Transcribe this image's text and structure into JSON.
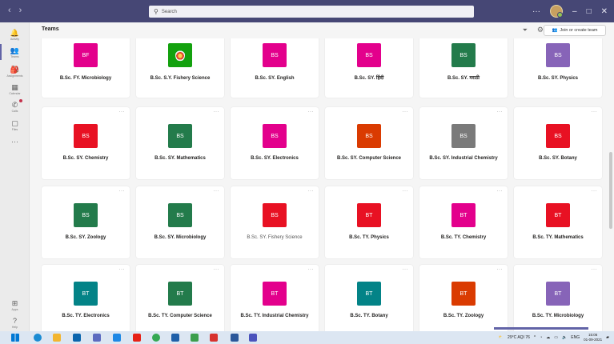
{
  "titlebar": {
    "back": "‹",
    "forward": "›",
    "search_placeholder": "Search",
    "more": "···",
    "minimize": "–",
    "maximize": "□",
    "close": "✕"
  },
  "rail": [
    {
      "name": "activity",
      "icon": "🔔",
      "label": "Activity"
    },
    {
      "name": "teams",
      "icon": "👥",
      "label": "Teams"
    },
    {
      "name": "assignments",
      "icon": "🎒",
      "label": "Assignments"
    },
    {
      "name": "calendar",
      "icon": "▦",
      "label": "Calendar"
    },
    {
      "name": "calls",
      "icon": "✆",
      "label": "Calls"
    },
    {
      "name": "files",
      "icon": "▢",
      "label": "Files"
    },
    {
      "name": "more",
      "icon": "···",
      "label": ""
    },
    {
      "name": "apps",
      "icon": "⊞",
      "label": "Apps"
    },
    {
      "name": "help",
      "icon": "?",
      "label": "Help"
    }
  ],
  "header": {
    "title": "Teams",
    "join_label": "Join or create team"
  },
  "cards": [
    {
      "initials": "BF",
      "color": "#e3008c",
      "name": "B.Sc. FY. Microbiology"
    },
    {
      "initials": "",
      "color": "#13a10e",
      "name": "B.Sc. S.Y. Fishery Science",
      "image": true
    },
    {
      "initials": "BS",
      "color": "#e3008c",
      "name": "B.Sc. SY. English"
    },
    {
      "initials": "BS",
      "color": "#e3008c",
      "name": "B.Sc. SY. हिंदी"
    },
    {
      "initials": "BS",
      "color": "#237b4b",
      "name": "B.Sc. SY. मराठी"
    },
    {
      "initials": "BS",
      "color": "#8764b8",
      "name": "B.Sc. SY. Physics"
    },
    {
      "initials": "BS",
      "color": "#e81123",
      "name": "B.Sc. SY. Chemistry"
    },
    {
      "initials": "BS",
      "color": "#237b4b",
      "name": "B.Sc. SY. Mathematics"
    },
    {
      "initials": "BS",
      "color": "#e3008c",
      "name": "B.Sc. SY. Electronics"
    },
    {
      "initials": "BS",
      "color": "#da3b01",
      "name": "B.Sc. SY. Computer Science"
    },
    {
      "initials": "BS",
      "color": "#7a7a7a",
      "name": "B.Sc. SY. Industrial Chemistry"
    },
    {
      "initials": "BS",
      "color": "#e81123",
      "name": "B.Sc. SY. Botany"
    },
    {
      "initials": "BS",
      "color": "#237b4b",
      "name": "B.Sc. SY. Zoology"
    },
    {
      "initials": "BS",
      "color": "#237b4b",
      "name": "B.Sc. SY. Microbiology"
    },
    {
      "initials": "BS",
      "color": "#e81123",
      "name": "B.Sc. SY. Fishery Science",
      "light": true
    },
    {
      "initials": "BT",
      "color": "#e81123",
      "name": "B.Sc. TY. Physics"
    },
    {
      "initials": "BT",
      "color": "#e3008c",
      "name": "B.Sc. TY. Chemistry"
    },
    {
      "initials": "BT",
      "color": "#e81123",
      "name": "B.Sc. TY. Mathematics"
    },
    {
      "initials": "BT",
      "color": "#038387",
      "name": "B.Sc. TY. Electronics"
    },
    {
      "initials": "BT",
      "color": "#237b4b",
      "name": "B.Sc. TY. Computer Science"
    },
    {
      "initials": "BT",
      "color": "#e3008c",
      "name": "B.Sc. TY. Industrial Chemistry"
    },
    {
      "initials": "BT",
      "color": "#038387",
      "name": "B.Sc. TY. Botany"
    },
    {
      "initials": "BT",
      "color": "#da3b01",
      "name": "B.Sc. TY. Zoology"
    },
    {
      "initials": "BT",
      "color": "#8764b8",
      "name": "B.Sc. TY. Microbiology"
    }
  ],
  "card_more": "···",
  "taskbar": {
    "apps": [
      {
        "name": "windows-start",
        "color": "#0078d4"
      },
      {
        "name": "edge",
        "color": "#1a8bd3"
      },
      {
        "name": "file-explorer",
        "color": "#f2b530"
      },
      {
        "name": "mail",
        "color": "#0a64ad"
      },
      {
        "name": "whiteboard",
        "color": "#5c6bc0"
      },
      {
        "name": "chat",
        "color": "#1e88e5"
      },
      {
        "name": "youtube",
        "color": "#e62117"
      },
      {
        "name": "chrome",
        "color": "#34a853"
      },
      {
        "name": "photos",
        "color": "#1f5fa8"
      },
      {
        "name": "paint",
        "color": "#3c9e4c"
      },
      {
        "name": "acrobat",
        "color": "#d7322e"
      },
      {
        "name": "word",
        "color": "#2b579a"
      },
      {
        "name": "teams",
        "color": "#4b53bc"
      }
    ],
    "weather": "29°C  AQI 76",
    "lang": "ENG",
    "time": "15:06",
    "date": "01-09-2021"
  }
}
